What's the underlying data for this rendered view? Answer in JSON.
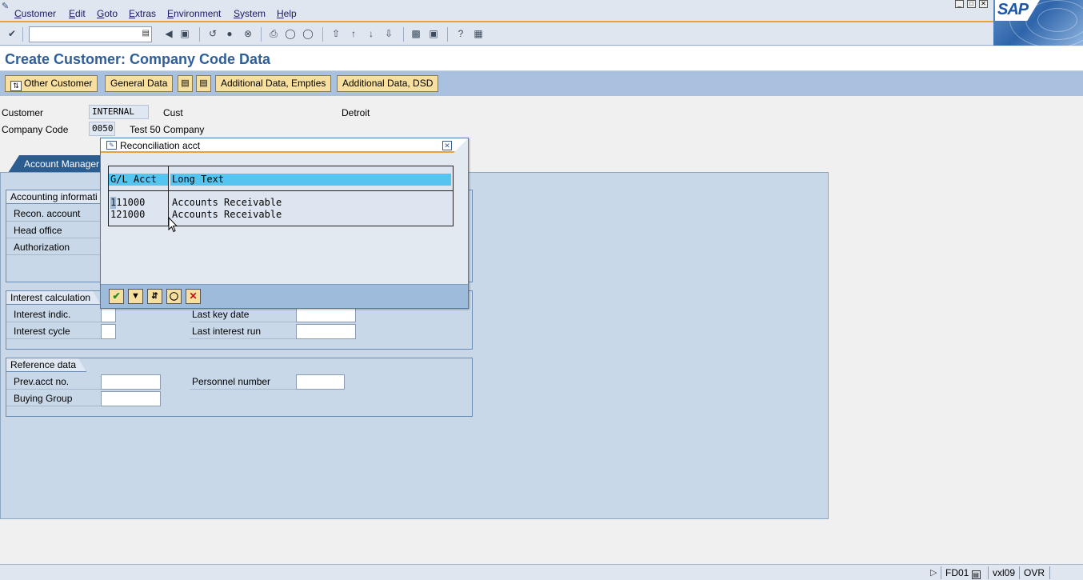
{
  "menubar": {
    "items": [
      "Customer",
      "Edit",
      "Goto",
      "Extras",
      "Environment",
      "System",
      "Help"
    ]
  },
  "logo": {
    "text": "SAP"
  },
  "toolbar": {
    "command_value": ""
  },
  "page": {
    "title": "Create Customer: Company Code Data"
  },
  "app_toolbar": {
    "other_customer": "Other Customer",
    "general_data": "General Data",
    "add_empties": "Additional Data, Empties",
    "add_dsd": "Additional Data, DSD"
  },
  "header": {
    "customer_label": "Customer",
    "customer_value": "INTERNAL",
    "customer_name": "Cust",
    "customer_city": "Detroit",
    "cc_label": "Company Code",
    "cc_value": "0050",
    "cc_name": "Test 50 Company"
  },
  "tab": {
    "label": "Account Manager"
  },
  "groups": {
    "accounting": {
      "title": "Accounting informati",
      "recon": "Recon. account",
      "head_office": "Head office",
      "authorization": "Authorization"
    },
    "interest": {
      "title": "Interest calculation",
      "indic": "Interest indic.",
      "cycle": "Interest cycle",
      "last_key_date": "Last key date",
      "last_run": "Last interest run"
    },
    "reference": {
      "title": "Reference data",
      "prev_acct": "Prev.acct no.",
      "buying_group": "Buying Group",
      "personnel": "Personnel number"
    }
  },
  "dialog": {
    "title": "Reconciliation acct",
    "columns": [
      "G/L Acct",
      "Long Text"
    ],
    "rows": [
      {
        "acct": "111000",
        "text": "Accounts Receivable"
      },
      {
        "acct": "121000",
        "text": "Accounts Receivable"
      }
    ]
  },
  "statusbar": {
    "tcode": "FD01",
    "server": "vxl09",
    "mode": "OVR"
  },
  "colors": {
    "accent": "#e8a23c",
    "title": "#2f5f9a",
    "panel": "#c9d8e8",
    "button": "#f7df9f",
    "header_highlight": "#55c5f0"
  }
}
